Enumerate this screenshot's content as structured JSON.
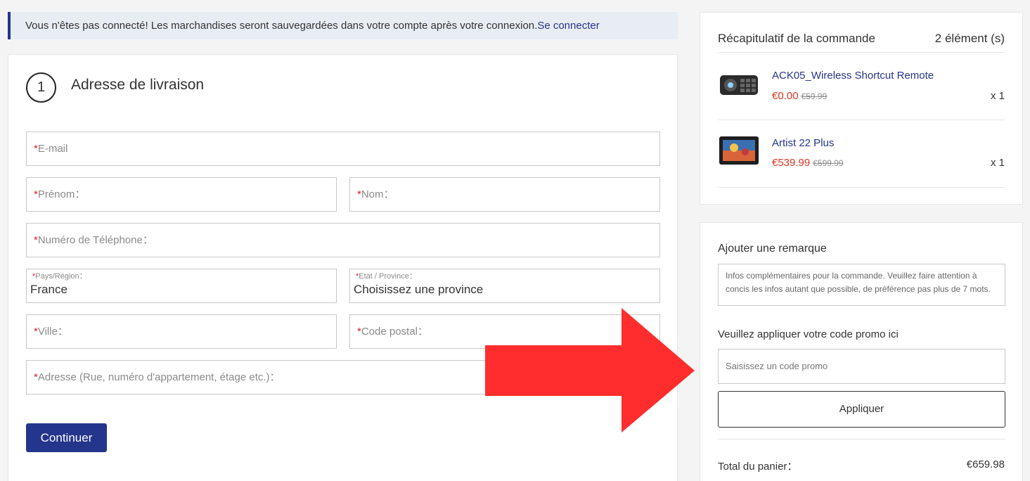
{
  "notice": {
    "text": "Vous n'êtes pas connecté! Les marchandises seront sauvegardées dans votre compte après votre connexion.",
    "link": "Se connecter"
  },
  "shipping": {
    "step_number": "1",
    "title": "Adresse de livraison",
    "required_mark": "*",
    "email_placeholder": "E-mail",
    "firstname_placeholder": "Prénom：",
    "lastname_placeholder": "Nom：",
    "phone_placeholder": "Numéro de Téléphone：",
    "country_label": "Pays/Région：",
    "country_value": "France",
    "province_label": "Etat / Province：",
    "province_value": "Choisissez une province",
    "city_placeholder": "Ville：",
    "postal_placeholder": "Code postal：",
    "address_placeholder": "Adresse (Rue, numéro d'appartement, étage etc.)：",
    "continue_label": "Continuer"
  },
  "summary": {
    "title": "Récapitulatif de la commande",
    "count": "2 élément (s)",
    "items": [
      {
        "name": "ACK05_Wireless Shortcut Remote",
        "price": "€0.00",
        "old_price": "€59.99",
        "qty": "x 1",
        "image_icon": "remote-product-image"
      },
      {
        "name": "Artist 22 Plus",
        "price": "€539.99",
        "old_price": "€599.99",
        "qty": "x 1",
        "image_icon": "display-product-image"
      }
    ]
  },
  "remark": {
    "title": "Ajouter une remarque",
    "placeholder": "Infos complémentaires pour la commande. Veuillez faire attention à concis les infos autant que possible, de préférence pas plus de 7 mots."
  },
  "promo": {
    "title": "Veuillez appliquer votre code promo ici",
    "placeholder": "Saisissez un code promo",
    "apply_label": "Appliquer"
  },
  "total": {
    "label": "Total du panier：",
    "value": "€659.98"
  },
  "colors": {
    "accent": "#24358c",
    "price": "#e0341e",
    "arrow": "#ff2d2d"
  }
}
